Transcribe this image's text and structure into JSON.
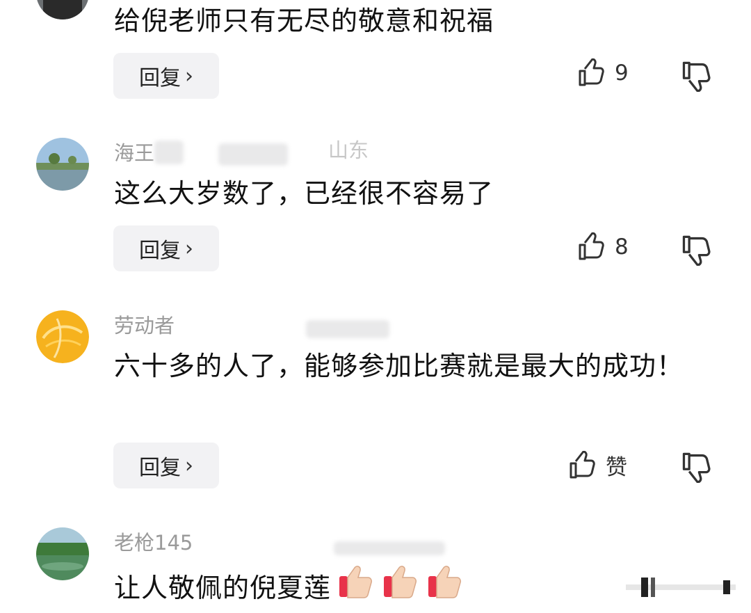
{
  "comments": [
    {
      "username": "",
      "text": "给倪老师只有无尽的敬意和祝福",
      "reply_label": "回复",
      "likes": "9"
    },
    {
      "username": "海王",
      "location": "山东",
      "text": "这么大岁数了，已经很不容易了",
      "reply_label": "回复",
      "likes": "8"
    },
    {
      "username": "劳动者",
      "text": "六十多的人了，能够参加比赛就是最大的成功！",
      "reply_label": "回复",
      "likes": "赞"
    },
    {
      "username": "老枪145",
      "text": "让人敬佩的倪夏莲"
    }
  ],
  "icons": {
    "reply_chevron": "›",
    "like": "thumbs-up-outline-icon",
    "dislike": "thumbs-down-outline-icon",
    "emoji": "thumbs-up-emoji"
  },
  "colors": {
    "username": "#9a9a9a",
    "text": "#111111",
    "reply_bg": "#f2f2f4"
  }
}
